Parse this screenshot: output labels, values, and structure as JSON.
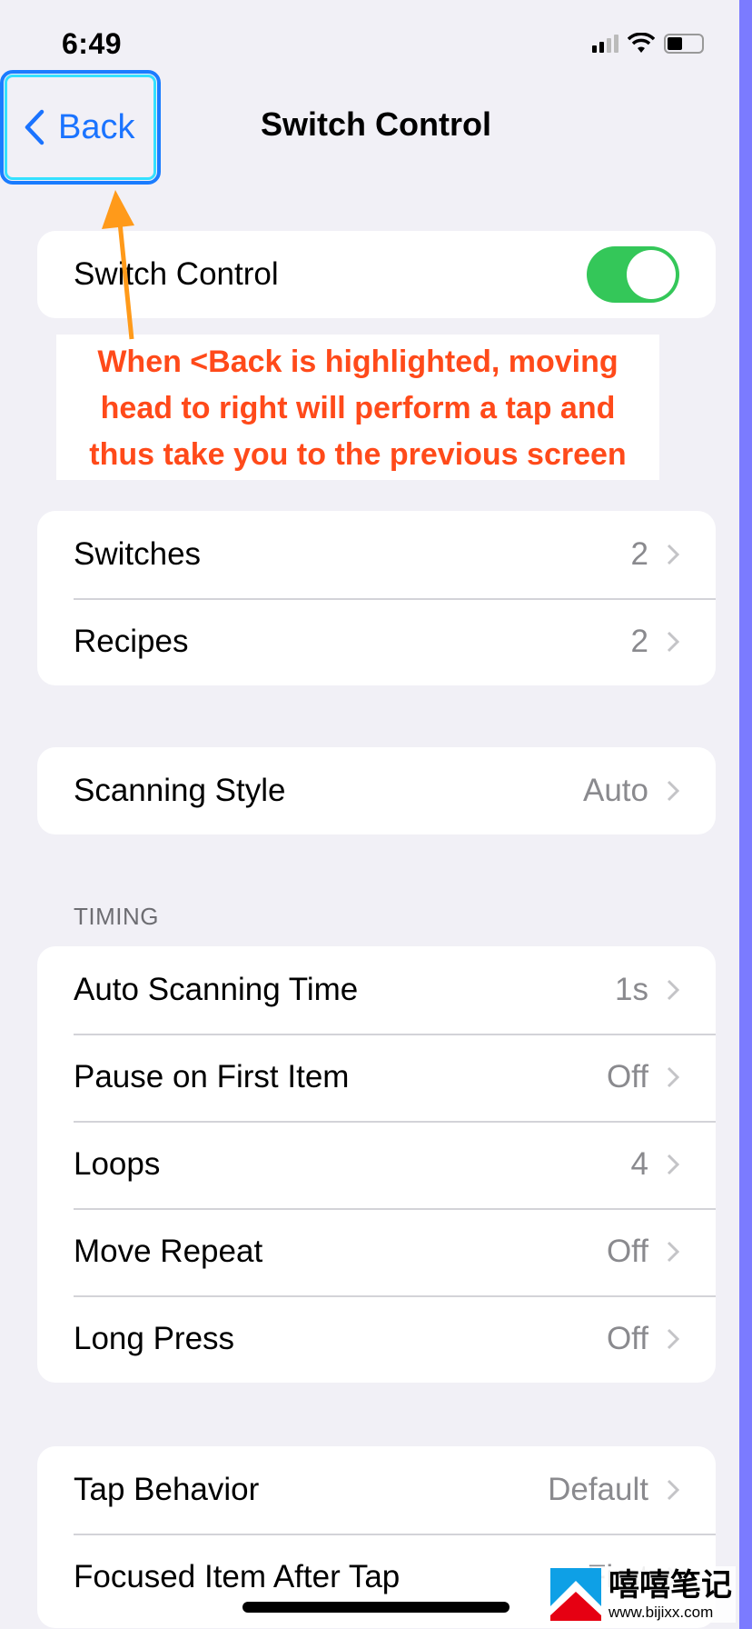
{
  "status_bar": {
    "time": "6:49",
    "icons": [
      "cellular-signal-icon",
      "wifi-icon",
      "battery-icon"
    ]
  },
  "nav": {
    "back_label": "Back",
    "title": "Switch Control"
  },
  "main_toggle": {
    "label": "Switch Control",
    "on": true
  },
  "annotation": {
    "lines": [
      "When <Back is highlighted, moving",
      "head to right will perform a tap and",
      "thus take you to the previous screen"
    ],
    "color": "#ff4a1a"
  },
  "group1": [
    {
      "label": "Switches",
      "value": "2"
    },
    {
      "label": "Recipes",
      "value": "2"
    }
  ],
  "group2": [
    {
      "label": "Scanning Style",
      "value": "Auto"
    }
  ],
  "timing": {
    "header": "TIMING",
    "items": [
      {
        "label": "Auto Scanning Time",
        "value": "1s"
      },
      {
        "label": "Pause on First Item",
        "value": "Off"
      },
      {
        "label": "Loops",
        "value": "4"
      },
      {
        "label": "Move Repeat",
        "value": "Off"
      },
      {
        "label": "Long Press",
        "value": "Off"
      }
    ]
  },
  "group4": [
    {
      "label": "Tap Behavior",
      "value": "Default"
    },
    {
      "label": "Focused Item After Tap",
      "value": "First"
    }
  ],
  "watermark": {
    "cn": "嘻嘻笔记",
    "url": "www.bijixx.com"
  },
  "colors": {
    "accent": "#1a73ff",
    "toggle_on": "#34c759",
    "highlight": "#34e0ff",
    "arrow": "#ff9a1a",
    "side_strip": "#7b7bff"
  }
}
